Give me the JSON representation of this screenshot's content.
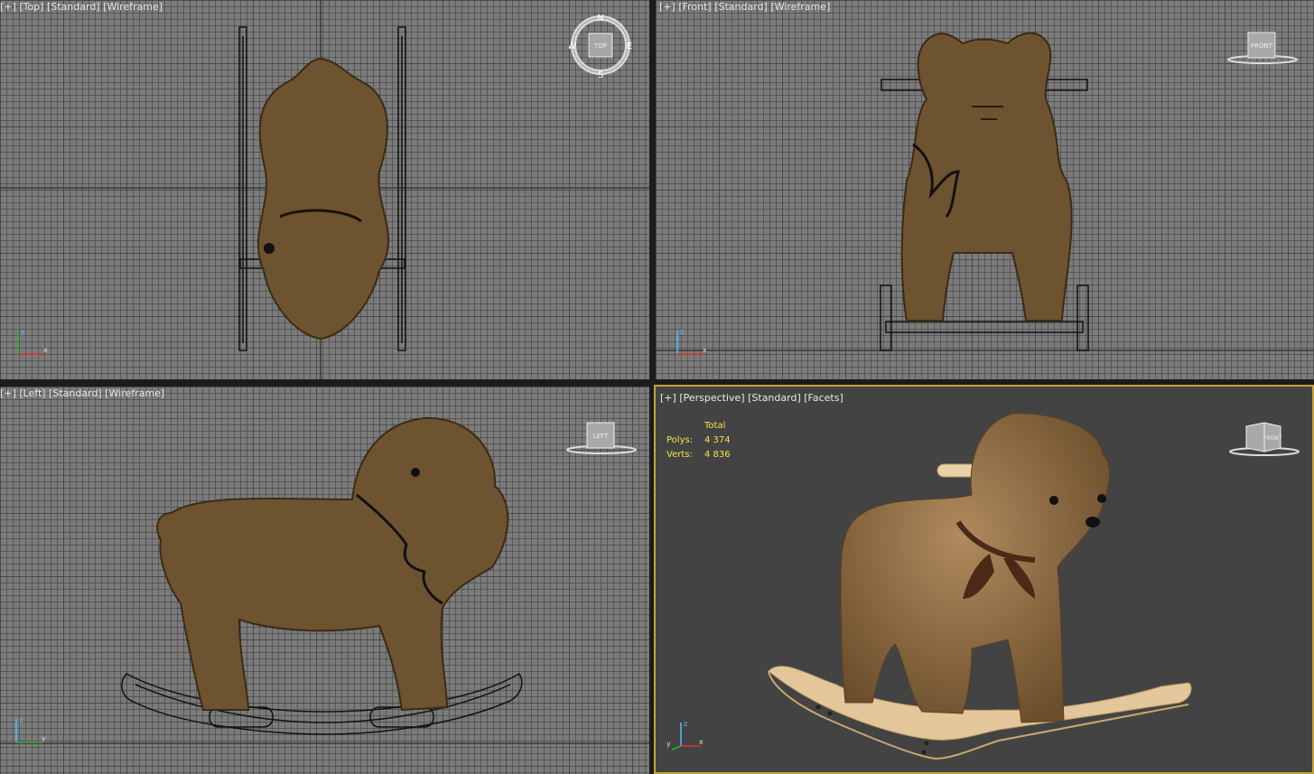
{
  "viewports": {
    "top": {
      "plus": "[+]",
      "view": "[Top]",
      "shading_mode": "[Standard]",
      "render": "[Wireframe]",
      "cube_label": "TOP",
      "compass": {
        "n": "N",
        "s": "S",
        "e": "E",
        "w": "W"
      }
    },
    "front": {
      "plus": "[+]",
      "view": "[Front]",
      "shading_mode": "[Standard]",
      "render": "[Wireframe]",
      "cube_label": "FRONT"
    },
    "left": {
      "plus": "[+]",
      "view": "[Left]",
      "shading_mode": "[Standard]",
      "render": "[Wireframe]",
      "cube_label": "LEFT"
    },
    "perspective": {
      "plus": "[+]",
      "view": "[Perspective]",
      "shading_mode": "[Standard]",
      "render": "[Facets]",
      "cube_label": "FRONT",
      "stats": {
        "header": "Total",
        "polys_label": "Polys:",
        "polys_value": "4 374",
        "verts_label": "Verts:",
        "verts_value": "4 836"
      }
    }
  },
  "axis_labels": {
    "x": "x",
    "y": "y",
    "z": "z"
  },
  "colors": {
    "active_border": "#c8a23a",
    "stats_text": "#f2e34a",
    "fur": "#8a6a40",
    "wood": "#e3c79a"
  }
}
